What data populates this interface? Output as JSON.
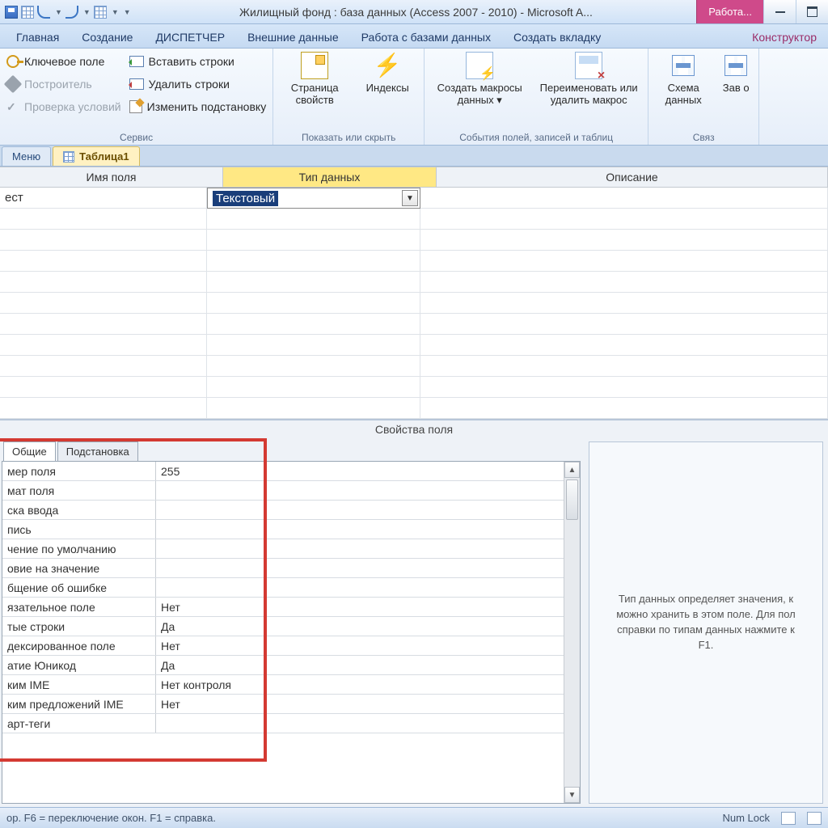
{
  "title": "Жилищный фонд : база данных (Access 2007 - 2010)  -  Microsoft A...",
  "contextual_tab": "Работа...",
  "ribbon_tabs": [
    "Главная",
    "Создание",
    "ДИСПЕТЧЕР",
    "Внешние данные",
    "Работа с базами данных",
    "Создать вкладку"
  ],
  "contextual_ribbon": "Конструктор",
  "ribbon": {
    "tools": {
      "key": "Ключевое поле",
      "builder": "Построитель",
      "validate": "Проверка условий",
      "insert": "Вставить строки",
      "delete": "Удалить строки",
      "lookup": "Изменить подстановку",
      "group": "Сервис"
    },
    "show": {
      "propsheet": "Страница свойств",
      "indexes": "Индексы",
      "group": "Показать или скрыть"
    },
    "events": {
      "create": "Создать макросы данных ▾",
      "rename": "Переименовать или удалить макрос",
      "group": "События полей, записей и таблиц"
    },
    "rel": {
      "schema": "Схема данных",
      "deps": "Зав\nо",
      "group": "Связ"
    }
  },
  "doc_tabs": {
    "menu": "Меню",
    "table": "Таблица1"
  },
  "grid": {
    "headers": {
      "field": "Имя поля",
      "type": "Тип данных",
      "desc": "Описание"
    },
    "row1_field": "ест",
    "row1_type": "Текстовый"
  },
  "props": {
    "title": "Свойства поля",
    "tabs": {
      "general": "Общие",
      "lookup": "Подстановка"
    },
    "rows": [
      {
        "l": "мер поля",
        "v": "255"
      },
      {
        "l": "мат поля",
        "v": ""
      },
      {
        "l": "ска ввода",
        "v": ""
      },
      {
        "l": "пись",
        "v": ""
      },
      {
        "l": "чение по умолчанию",
        "v": ""
      },
      {
        "l": "овие на значение",
        "v": ""
      },
      {
        "l": "бщение об ошибке",
        "v": ""
      },
      {
        "l": "язательное поле",
        "v": "Нет"
      },
      {
        "l": "тые строки",
        "v": "Да"
      },
      {
        "l": "дексированное поле",
        "v": "Нет"
      },
      {
        "l": "атие Юникод",
        "v": "Да"
      },
      {
        "l": "ким IME",
        "v": "Нет контроля"
      },
      {
        "l": "ким предложений IME",
        "v": "Нет"
      },
      {
        "l": "арт-теги",
        "v": ""
      }
    ],
    "help": "Тип данных определяет значения, к\nможно хранить в этом поле. Для пол\nсправки по типам данных нажмите к\nF1."
  },
  "status": {
    "left": "ор.  F6 = переключение окон.  F1 = справка.",
    "numlock": "Num Lock"
  }
}
